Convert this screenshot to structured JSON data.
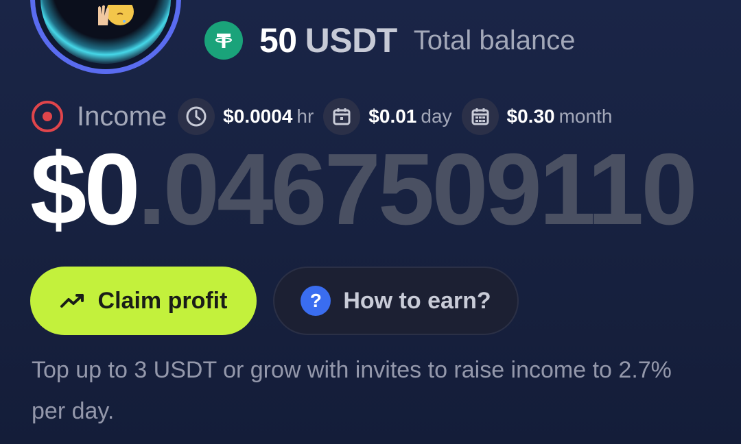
{
  "avatar": {
    "icon": "emoji-hand-face-icon"
  },
  "balance": {
    "icon": "tether-icon",
    "amount": "50",
    "unit": "USDT",
    "label": "Total balance"
  },
  "income": {
    "icon": "target-icon",
    "label": "Income",
    "rates": [
      {
        "icon": "clock-icon",
        "value": "$0.0004",
        "unit": "hr"
      },
      {
        "icon": "calendar-day-icon",
        "value": "$0.01",
        "unit": "day"
      },
      {
        "icon": "calendar-month-icon",
        "value": "$0.30",
        "unit": "month"
      }
    ]
  },
  "counter": {
    "integer": "$0",
    "fraction": ".0467509110"
  },
  "buttons": {
    "claim": {
      "icon": "trending-up-icon",
      "label": "Claim profit",
      "color": "#c3f13c"
    },
    "how": {
      "icon": "question-icon",
      "icon_glyph": "?",
      "label": "How to earn?"
    }
  },
  "info": {
    "text": "Top up to 3 USDT or grow with invites to raise income to 2.7% per day."
  },
  "colors": {
    "background": "#1a2547",
    "accent_green": "#c3f13c",
    "tether_green": "#1aa37a",
    "question_blue": "#3a6df0",
    "target_red": "#e0454b"
  }
}
